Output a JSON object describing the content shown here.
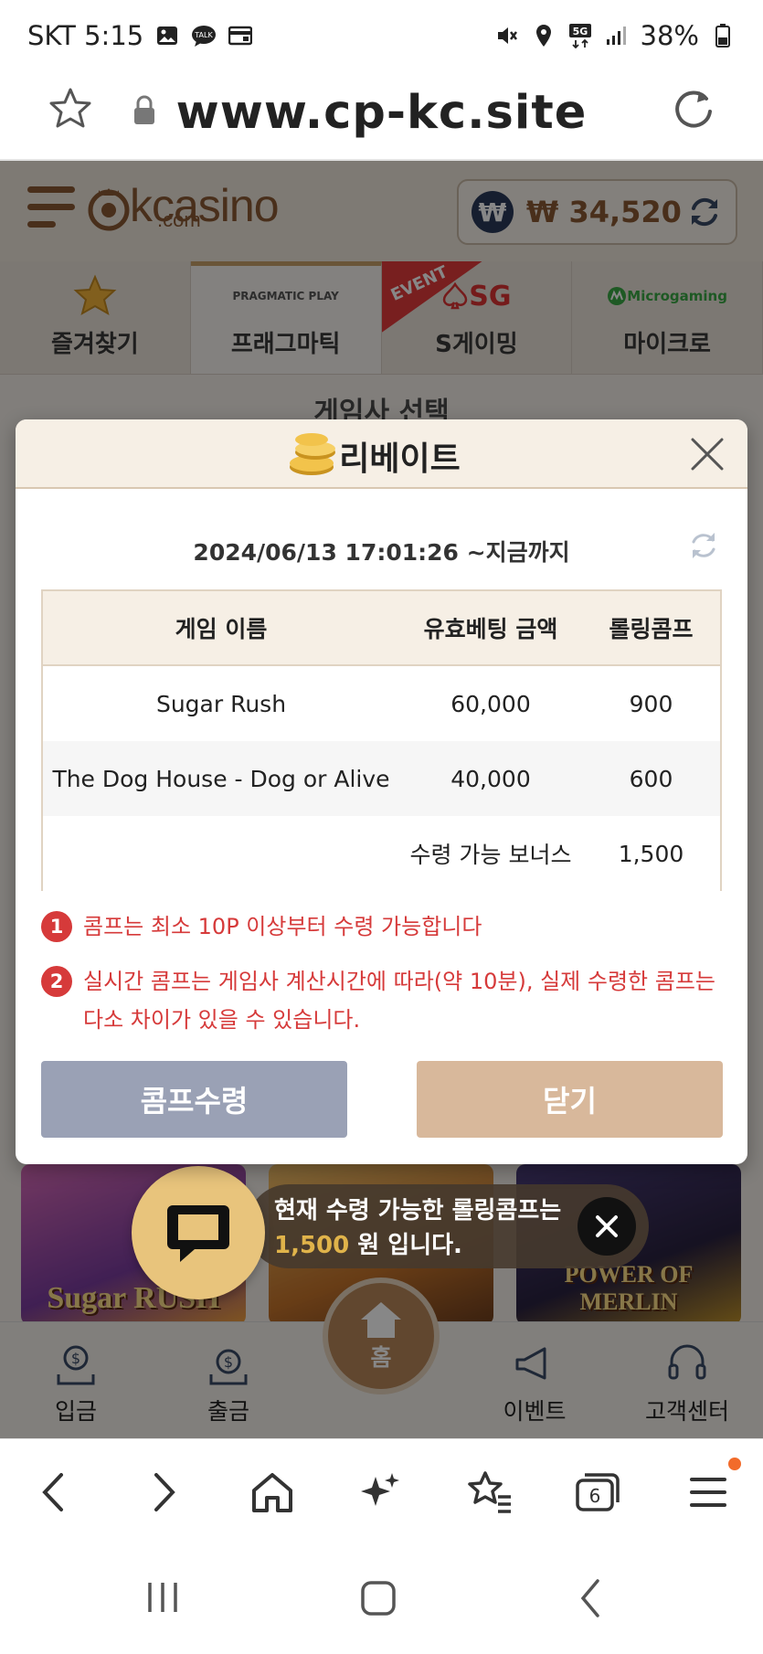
{
  "status_bar": {
    "carrier_time": "SKT 5:15",
    "network": "5G",
    "battery": "38%"
  },
  "browser": {
    "url": "www.cp-kc.site",
    "tab_count": "6"
  },
  "site": {
    "brand": "kcasino",
    "brand_suffix": ".com",
    "balance": "₩ 34,520",
    "currency_symbol": "₩",
    "tabs": [
      {
        "label": "즐겨찾기",
        "logo": ""
      },
      {
        "label": "프래그마틱",
        "logo": "PRAGMATIC PLAY"
      },
      {
        "label": "S게이밍",
        "logo": "SG",
        "ribbon": "EVENT"
      },
      {
        "label": "마이크로",
        "logo": "Microgaming"
      }
    ],
    "section_title": "게임사 선택",
    "games": [
      "Sugar RUSH",
      "",
      "POWER OF MERLIN"
    ],
    "notice": {
      "line1": "현재 수령 가능한 롤링콤프는",
      "amount": "1,500",
      "line2_suffix": " 원 입니다."
    },
    "nav": {
      "deposit": "입금",
      "withdraw": "출금",
      "home": "홈",
      "event": "이벤트",
      "support": "고객센터"
    }
  },
  "modal": {
    "title": "리베이트",
    "period": "2024/06/13 17:01:26 ~지금까지",
    "table": {
      "headers": [
        "게임 이름",
        "유효베팅 금액",
        "롤링콤프"
      ],
      "rows": [
        [
          "Sugar Rush",
          "60,000",
          "900"
        ],
        [
          "The Dog House - Dog or Alive",
          "40,000",
          "600"
        ]
      ],
      "total_label": "수령 가능 보너스",
      "total_value": "1,500"
    },
    "notes": [
      {
        "num": "1",
        "text": "콤프는 최소 10P 이상부터 수령 가능합니다"
      },
      {
        "num": "2",
        "text": "실시간 콤프는 게임사 계산시간에 따라(약 10분), 실제 수령한 콤프는 다소 차이가 있을 수 있습니다."
      }
    ],
    "claim_button": "콤프수령",
    "close_button": "닫기"
  },
  "colors": {
    "accent": "#b8875a",
    "note_red": "#d63a3a",
    "claim_btn": "#9aa1b5",
    "close_btn": "#d8b89b"
  }
}
